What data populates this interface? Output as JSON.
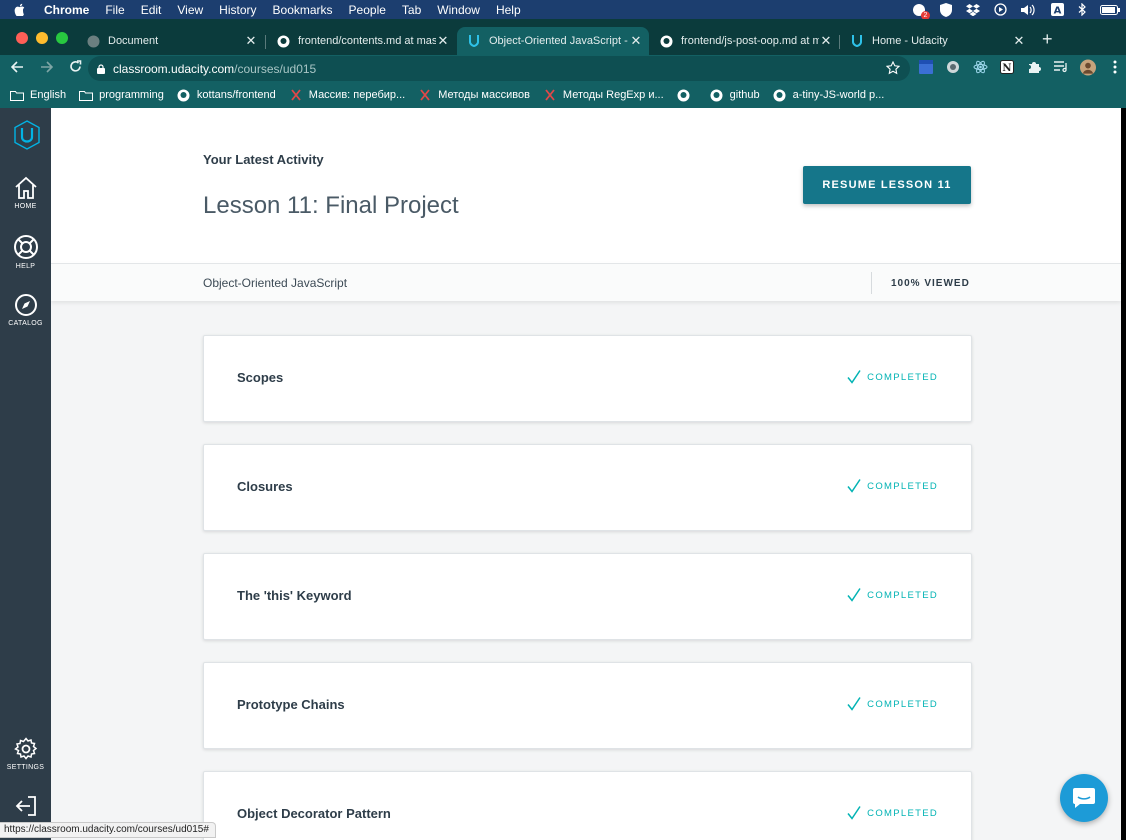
{
  "menubar": {
    "app_name": "Chrome",
    "items": [
      "File",
      "Edit",
      "View",
      "History",
      "Bookmarks",
      "People",
      "Tab",
      "Window",
      "Help"
    ],
    "notification_count": "2"
  },
  "tabs": [
    {
      "title": "Document",
      "active": false
    },
    {
      "title": "frontend/contents.md at master",
      "active": false
    },
    {
      "title": "Object-Oriented JavaScript - Udacity",
      "active": true
    },
    {
      "title": "frontend/js-post-oop.md at master",
      "active": false
    },
    {
      "title": "Home - Udacity",
      "active": false
    }
  ],
  "address": {
    "host": "classroom.udacity.com",
    "path": "/courses/ud015"
  },
  "bookmarks": [
    {
      "label": "English",
      "icon": "folder-icon"
    },
    {
      "label": "programming",
      "icon": "folder-icon"
    },
    {
      "label": "kottans/frontend",
      "icon": "github-icon"
    },
    {
      "label": "Массив: перебир...",
      "icon": "x-icon"
    },
    {
      "label": "Методы массивов",
      "icon": "x-icon"
    },
    {
      "label": "Методы RegExp и...",
      "icon": "x-icon"
    },
    {
      "label": "",
      "icon": "github-icon"
    },
    {
      "label": "github",
      "icon": "github-icon"
    },
    {
      "label": "a-tiny-JS-world p...",
      "icon": "github-icon"
    }
  ],
  "sidebar": {
    "home": "HOME",
    "help": "HELP",
    "catalog": "CATALOG",
    "settings": "SETTINGS"
  },
  "activity": {
    "label": "Your Latest Activity",
    "lesson_title": "Lesson 11: Final Project",
    "resume_button": "RESUME LESSON 11"
  },
  "course": {
    "name": "Object-Oriented JavaScript",
    "viewed": "100% VIEWED"
  },
  "lessons": [
    {
      "name": "Scopes",
      "status": "COMPLETED"
    },
    {
      "name": "Closures",
      "status": "COMPLETED"
    },
    {
      "name": "The 'this' Keyword",
      "status": "COMPLETED"
    },
    {
      "name": "Prototype Chains",
      "status": "COMPLETED"
    },
    {
      "name": "Object Decorator Pattern",
      "status": "COMPLETED"
    }
  ],
  "status_url": "https://classroom.udacity.com/courses/ud015#",
  "colors": {
    "accent": "#15768a",
    "completed": "#02b3b4",
    "sidebar": "#2e3d49",
    "chrome_frame": "#136063"
  }
}
